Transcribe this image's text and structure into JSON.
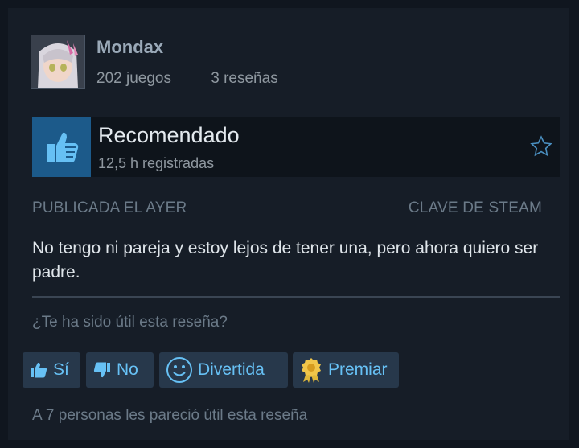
{
  "user": {
    "name": "Mondax",
    "games": "202 juegos",
    "reviews": "3 reseñas"
  },
  "review": {
    "verdict": "Recomendado",
    "hours": "12,5 h registradas",
    "posted": "PUBLICADA EL AYER",
    "key_source": "CLAVE DE STEAM",
    "text": "No tengo ni pareja y estoy lejos de tener una, pero ahora quiero ser padre."
  },
  "feedback": {
    "question": "¿Te ha sido útil esta reseña?",
    "yes_label": "Sí",
    "no_label": "No",
    "funny_label": "Divertida",
    "award_label": "Premiar",
    "helpful_count": "A 7 personas les pareció útil esta reseña"
  },
  "colors": {
    "background": "#161d27",
    "thumb_box": "#1c5a8a",
    "button_bg": "#27384b",
    "button_text": "#67c1f5"
  },
  "icons": {
    "thumb": "thumbs-up-icon",
    "favorite": "star-outline-icon",
    "yes": "thumbs-up-icon",
    "no": "thumbs-down-icon",
    "funny": "smiley-icon",
    "award": "award-medal-icon"
  }
}
